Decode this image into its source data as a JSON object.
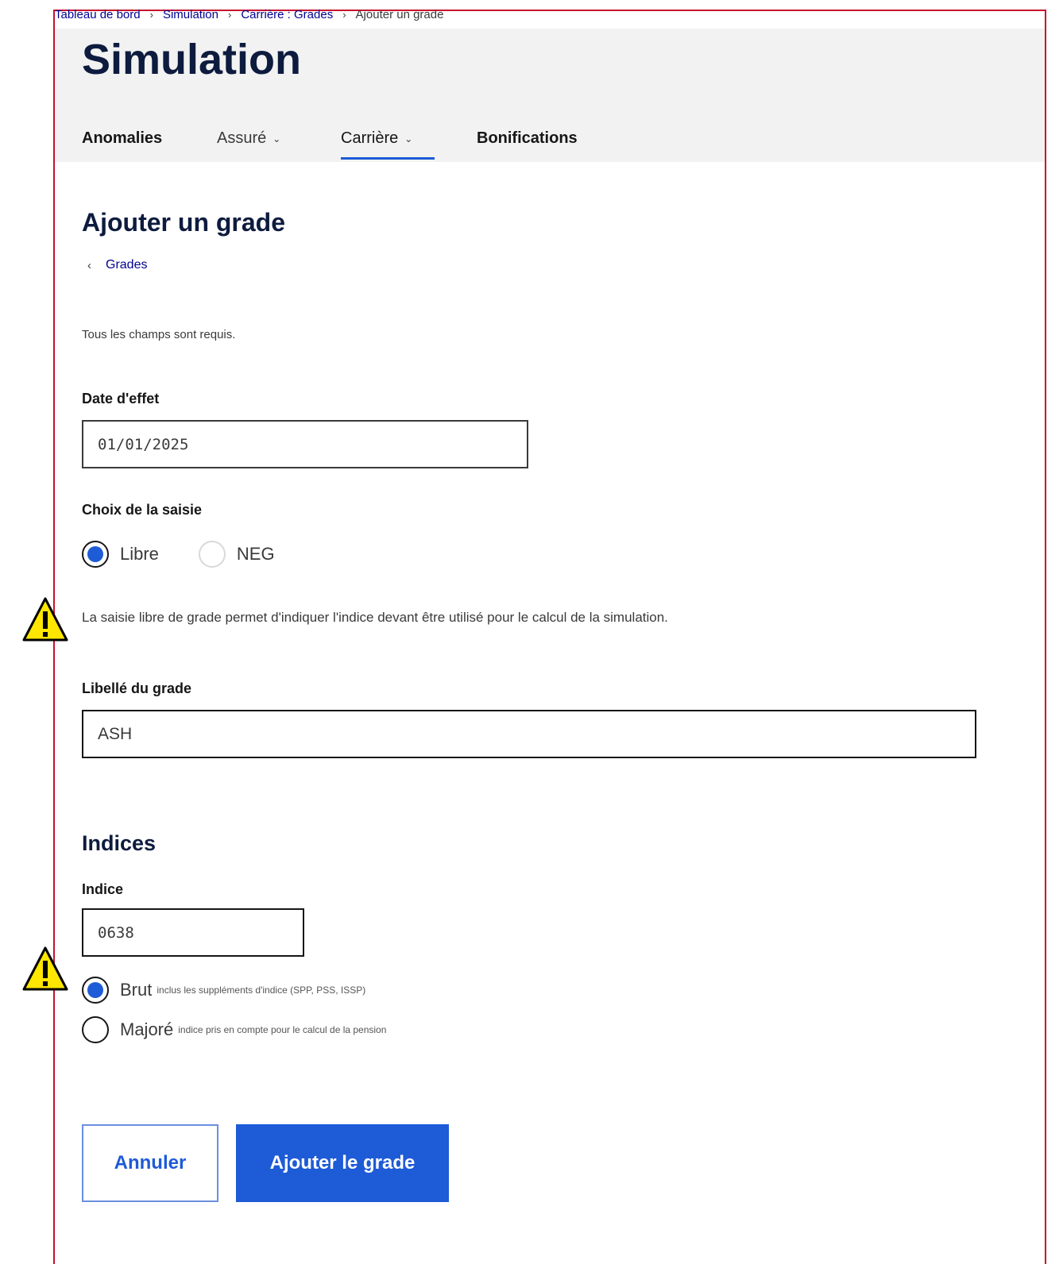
{
  "breadcrumb": {
    "items": [
      "Tableau de bord",
      "Simulation",
      "Carrière : Grades"
    ],
    "current": "Ajouter un grade",
    "separator": "›"
  },
  "page": {
    "title": "Simulation"
  },
  "tabs": [
    {
      "label": "Anomalies",
      "dropdown": false
    },
    {
      "label": "Assuré",
      "dropdown": true
    },
    {
      "label": "Carrière",
      "dropdown": true,
      "active": true
    },
    {
      "label": "Bonifications",
      "dropdown": false
    }
  ],
  "form": {
    "heading": "Ajouter un grade",
    "back_link": "Grades",
    "required_note": "Tous les champs sont requis.",
    "date_label": "Date d'effet",
    "date_value": "01/01/2025",
    "choice_label": "Choix de la saisie",
    "choice_options": [
      {
        "label": "Libre",
        "checked": true
      },
      {
        "label": "NEG",
        "checked": false
      }
    ],
    "info": "La saisie libre de grade permet d'indiquer l'indice devant être utilisé pour le calcul de la simulation.",
    "grade_label": "Libellé du grade",
    "grade_value": "ASH",
    "indices_heading": "Indices",
    "indice_label": "Indice",
    "indice_value": "0638",
    "indice_types": [
      {
        "label": "Brut",
        "hint": "inclus les suppléments d'indice (SPP, PSS, ISSP)",
        "checked": true
      },
      {
        "label": "Majoré",
        "hint": "indice pris en compte pour le calcul de la pension",
        "checked": false
      }
    ],
    "cancel_label": "Annuler",
    "submit_label": "Ajouter le grade"
  },
  "colors": {
    "accent": "#1e5bd6",
    "title": "#0d1b3e",
    "frame_border": "#c8102e",
    "warning": "#ffe600"
  },
  "icons": [
    "warning-icon",
    "chevron-down-icon",
    "chevron-left-icon"
  ]
}
